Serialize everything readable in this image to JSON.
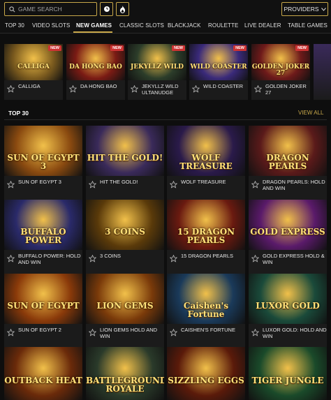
{
  "search": {
    "placeholder": "GAME SEARCH"
  },
  "header": {
    "providers_label": "PROVIDERS"
  },
  "nav": {
    "items": [
      {
        "label": "TOP 30"
      },
      {
        "label": "VIDEO SLOTS"
      },
      {
        "label": "NEW GAMES"
      },
      {
        "label": "CLASSIC SLOTS"
      },
      {
        "label": "BLACKJACK"
      },
      {
        "label": "ROULETTE"
      },
      {
        "label": "LIVE DEALER"
      },
      {
        "label": "TABLE GAMES"
      }
    ],
    "active": "NEW GAMES"
  },
  "new_games": {
    "badge": "NEW",
    "items": [
      {
        "name": "CALLIGA",
        "art_text": "CALLIGA",
        "color": "#7a5a1e"
      },
      {
        "name": "DA HONG BAO",
        "art_text": "DA HONG BAO",
        "color": "#7a1b14"
      },
      {
        "name": "JEKYLLZ WILD ULTANUDGE",
        "art_text": "JEKYLLZ WILD",
        "color": "#2c3d2a"
      },
      {
        "name": "WILD COASTER",
        "art_text": "WILD COASTER",
        "color": "#3a2a7a"
      },
      {
        "name": "GOLDEN JOKER 27",
        "art_text": "GOLDEN JOKER 27",
        "color": "#6e1a1a"
      }
    ]
  },
  "top30": {
    "title": "TOP 30",
    "view_all": "VIEW ALL",
    "items": [
      {
        "name": "SUN OF EGYPT 3",
        "art_text": "SUN OF EGYPT 3",
        "color": "#8a4a10"
      },
      {
        "name": "HIT THE GOLD!",
        "art_text": "HIT THE GOLD!",
        "color": "#3a2a5a"
      },
      {
        "name": "WOLF TREASURE",
        "art_text": "WOLF TREASURE",
        "color": "#2a1a4a"
      },
      {
        "name": "DRAGON PEARLS: HOLD AND WIN",
        "art_text": "DRAGON PEARLS",
        "color": "#5a1a1a"
      },
      {
        "name": "BUFFALO POWER: HOLD AND WIN",
        "art_text": "BUFFALO POWER",
        "color": "#2a2a6a"
      },
      {
        "name": "3 COINS",
        "art_text": "3 COINS",
        "color": "#5a3a0a"
      },
      {
        "name": "15 DRAGON PEARLS",
        "art_text": "15 DRAGON PEARLS",
        "color": "#6a1a10"
      },
      {
        "name": "GOLD EXPRESS HOLD & WIN",
        "art_text": "GOLD EXPRESS",
        "color": "#5a1a6a"
      },
      {
        "name": "SUN OF EGYPT 2",
        "art_text": "SUN OF EGYPT",
        "color": "#8a3a0a"
      },
      {
        "name": "LION GEMS HOLD AND WIN",
        "art_text": "LION GEMS",
        "color": "#7a3a0a"
      },
      {
        "name": "CAISHEN'S FORTUNE",
        "art_text": "Caishen's Fortune",
        "color": "#1a3a5a"
      },
      {
        "name": "LUXOR GOLD: HOLD AND WIN",
        "art_text": "LUXOR GOLD",
        "color": "#1a4a3a"
      },
      {
        "name": "",
        "art_text": "OUTBACK HEAT",
        "color": "#6a2a0a"
      },
      {
        "name": "",
        "art_text": "BATTLEGROUND ROYALE",
        "color": "#2a3a2a"
      },
      {
        "name": "",
        "art_text": "SIZZLING EGGS",
        "color": "#5a1a0a"
      },
      {
        "name": "",
        "art_text": "TIGER JUNGLE",
        "color": "#1a4a2a"
      }
    ]
  },
  "colors": {
    "accent": "#c8a84a",
    "background": "#0e0e0e",
    "badge": "#cc3333"
  }
}
